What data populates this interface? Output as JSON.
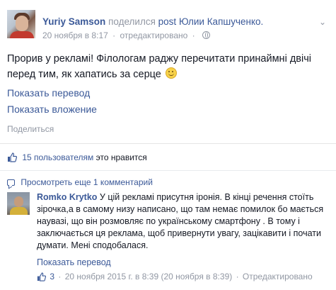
{
  "post": {
    "author": "Yuriy Samson",
    "shared_text": "поделился",
    "post_link": "post",
    "owner": "Юлии Капшученко.",
    "date": "20 ноября в 8:17",
    "edited": "отредактировано",
    "text": "Прорив у рекламі! Філологам раджу перечитати принаймні двічі перед тим, як хапатись за серце",
    "show_translation": "Показать перевод",
    "show_attachment": "Показать вложение",
    "share": "Поделиться"
  },
  "likes": {
    "count_link": "15 пользователям",
    "suffix": "это нравится"
  },
  "comments": {
    "view_more": "Просмотреть еще 1 комментарий",
    "items": [
      {
        "author": "Romko Krytko",
        "text": "У цій рекламі присутня іронія. В кінці речення стоїть зірочка,а в самому низу написано, що там немає помилок бо мається наувазі, що він розмовляє по українському смартфону . В тому і заключається ця реклама, щоб привернути увагу, зацікавити і почати думати. Мені сподобалася.",
        "show_translation": "Показать перевод",
        "likes": "3",
        "date": "20 ноября 2015 г. в 8:39 (20 ноября в 8:39)",
        "edited": "Отредактировано"
      }
    ]
  },
  "icons": {
    "privacy": "globe-icon",
    "options": "chevron-down-icon",
    "like": "thumbs-up-icon",
    "comment": "comment-bubble-icon",
    "emoji": "smile-emoji-icon"
  },
  "colors": {
    "link": "#3b5998",
    "muted": "#9197a3",
    "text": "#141823"
  }
}
